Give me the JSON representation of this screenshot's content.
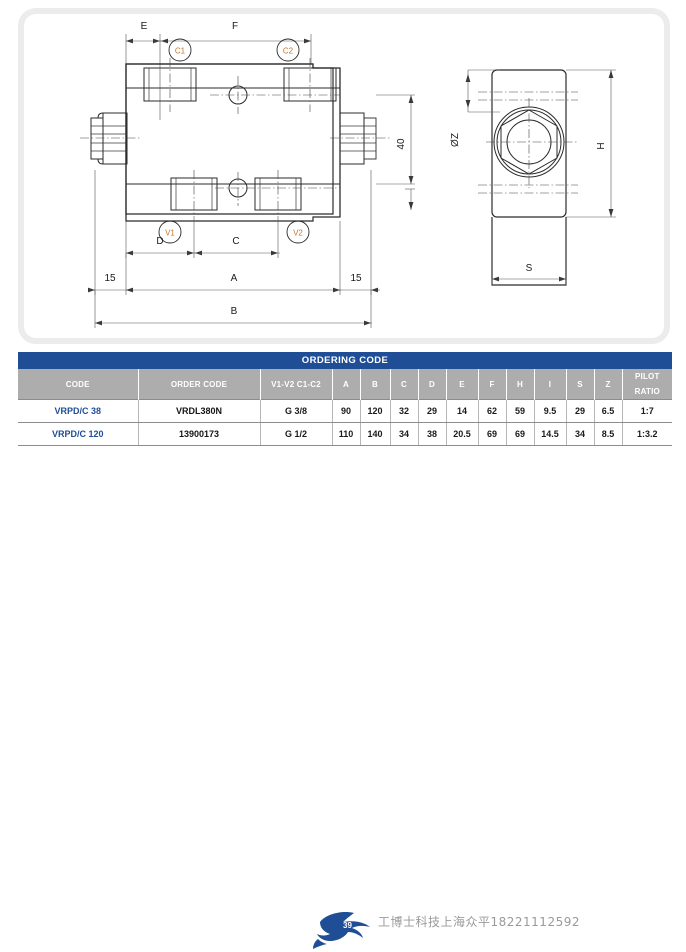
{
  "drawing": {
    "main_view": {
      "dimension_labels": [
        "E",
        "F",
        "C1",
        "C2",
        "40",
        "V1",
        "V2",
        "D",
        "C",
        "A",
        "B"
      ],
      "fixed_dims": [
        {
          "name": "left-margin",
          "value": "15"
        },
        {
          "name": "right-margin",
          "value": "15"
        },
        {
          "name": "height",
          "value": "40"
        }
      ],
      "port_callouts": [
        "C1",
        "C2",
        "V1",
        "V2"
      ],
      "label_E": "E",
      "label_F": "F",
      "label_C1": "C1",
      "label_C2": "C2",
      "label_40": "40",
      "label_V1": "V1",
      "label_V2": "V2",
      "label_D": "D",
      "label_C": "C",
      "label_A": "A",
      "label_B": "B",
      "label_15_left": "15",
      "label_15_right": "15"
    },
    "side_view": {
      "label_OZ": "ØZ",
      "label_H": "H",
      "label_S": "S"
    }
  },
  "table": {
    "title": "ORDERING CODE",
    "columns": [
      "CODE",
      "ORDER CODE",
      "V1-V2  C1-C2",
      "A",
      "B",
      "C",
      "D",
      "E",
      "F",
      "H",
      "I",
      "S",
      "Z",
      "PILOT RATIO"
    ],
    "rows": [
      {
        "code": "VRPD/C 38",
        "order_code": "VRDL380N",
        "ports": "G 3/8",
        "A": "90",
        "B": "120",
        "C": "32",
        "D": "29",
        "E": "14",
        "F": "62",
        "H": "59",
        "I": "9.5",
        "S": "29",
        "Z": "6.5",
        "pilot_ratio": "1:7"
      },
      {
        "code": "VRPD/C 120",
        "order_code": "13900173",
        "ports": "G 1/2",
        "A": "110",
        "B": "140",
        "C": "34",
        "D": "38",
        "E": "20.5",
        "F": "69",
        "H": "69",
        "I": "14.5",
        "S": "34",
        "Z": "8.5",
        "pilot_ratio": "1:3.2"
      }
    ]
  },
  "footer": {
    "page_number": "39",
    "watermark_text": "工博士科技上海众平18221112592",
    "logo_name": "dolphin-logo"
  },
  "colors": {
    "header_blue": "#1f4e96",
    "subheader_gray": "#adadad",
    "code_blue": "#1f4e96",
    "callout_orange": "#c8742a",
    "panel_border": "#ececec",
    "watermark_gray": "#9a9a9a"
  }
}
